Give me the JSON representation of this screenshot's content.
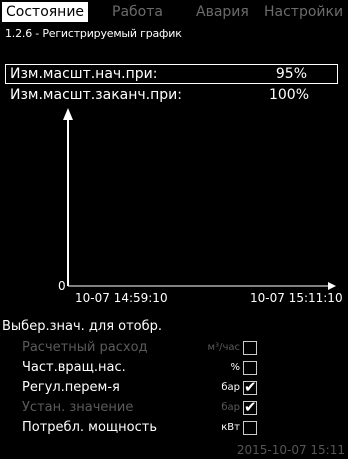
{
  "tabs": [
    {
      "label": "Состояние",
      "active": true
    },
    {
      "label": "Работа",
      "active": false
    },
    {
      "label": "Авария",
      "active": false
    },
    {
      "label": "Настройки",
      "active": false
    }
  ],
  "breadcrumb": "1.2.6 - Регистрируемый график",
  "params": [
    {
      "label": "Изм.масшт.нач.при:",
      "value": "95%",
      "selected": true
    },
    {
      "label": "Изм.масшт.заканч.при:",
      "value": "100%",
      "selected": false
    }
  ],
  "chart_data": {
    "type": "line",
    "y_origin_label": "0",
    "x_labels": [
      "10-07 14:59:10",
      "10-07 15:11:10"
    ],
    "grid": false,
    "series": []
  },
  "selection": {
    "title": "Выбер.знач. для отобр.",
    "items": [
      {
        "label": "Расчетный расход",
        "unit": "м³/час",
        "checked": false,
        "disabled": true
      },
      {
        "label": "Част.вращ.нас.",
        "unit": "%",
        "checked": false,
        "disabled": false
      },
      {
        "label": "Регул.перем-я",
        "unit": "бар",
        "checked": true,
        "disabled": false
      },
      {
        "label": "Устан. значение",
        "unit": "бар",
        "checked": true,
        "disabled": true
      },
      {
        "label": "Потребл. мощность",
        "unit": "кВт",
        "checked": false,
        "disabled": false
      }
    ]
  },
  "status_timestamp": "2015-10-07 15:11"
}
